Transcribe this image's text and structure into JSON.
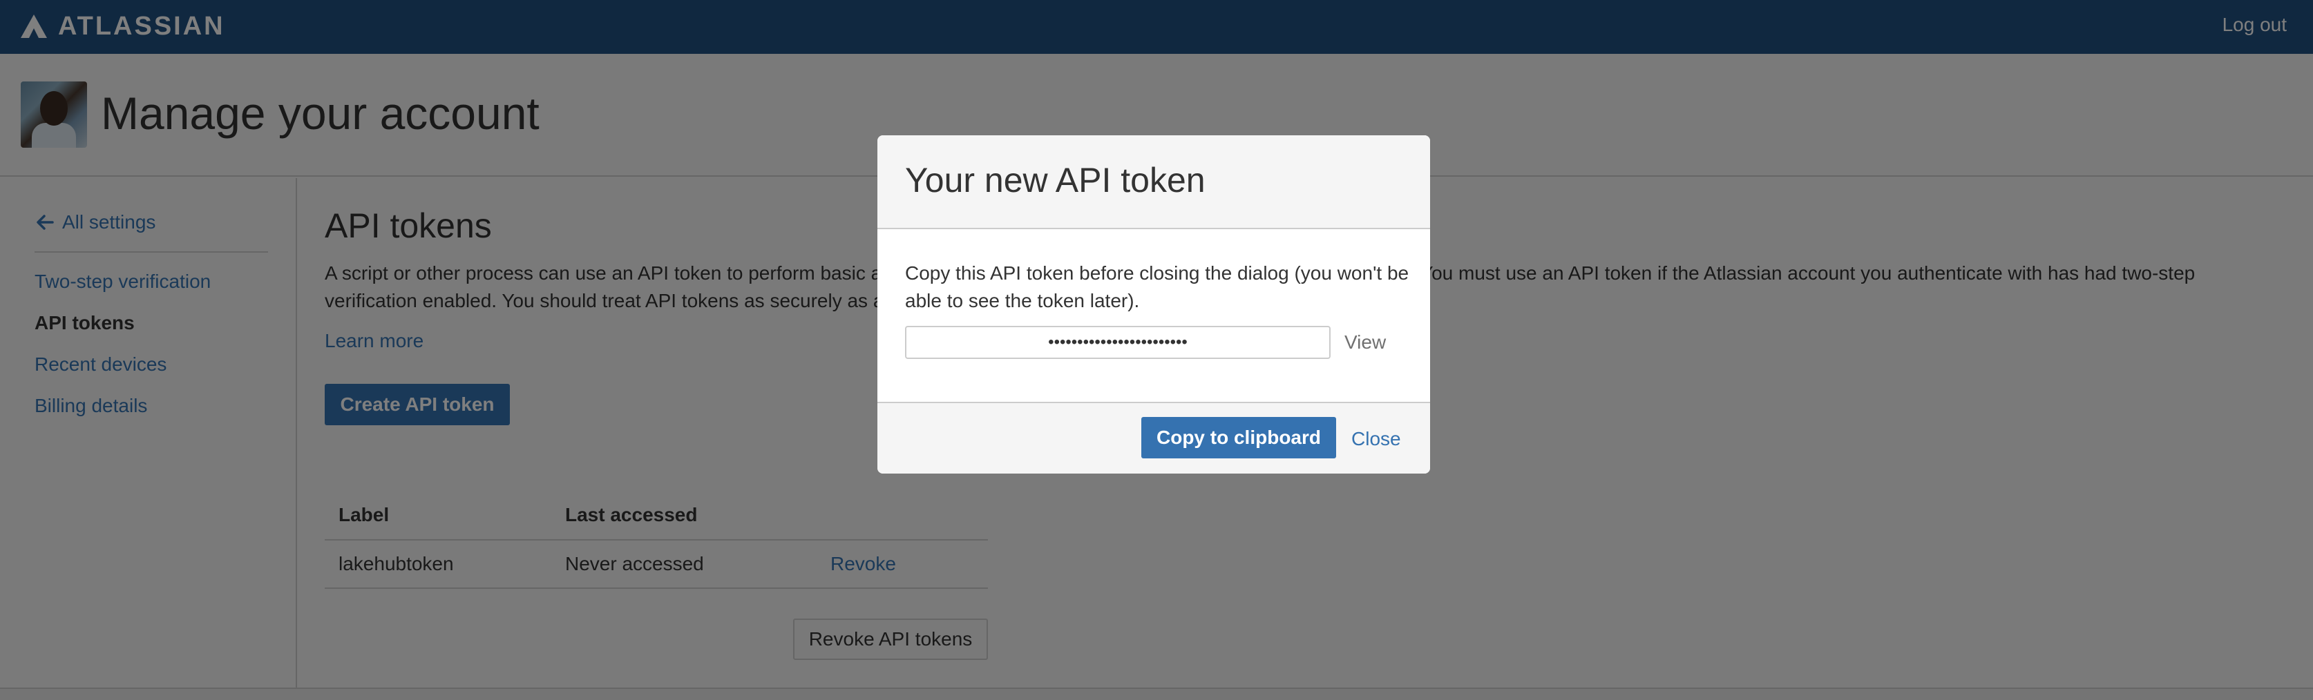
{
  "topbar": {
    "brand": "ATLASSIAN",
    "logout": "Log out"
  },
  "header": {
    "title": "Manage your account"
  },
  "sidebar": {
    "back_label": "All settings",
    "items": [
      {
        "label": "Two-step verification",
        "active": false
      },
      {
        "label": "API tokens",
        "active": true
      },
      {
        "label": "Recent devices",
        "active": false
      },
      {
        "label": "Billing details",
        "active": false
      }
    ]
  },
  "main": {
    "title": "API tokens",
    "description_line1": "A script or other process can use an API token to perform basic a",
    "description_line1_right": "You must use an API token if the Atlassian account you authenticate with has had two-step",
    "description_line2": "verification enabled. You should treat API tokens as securely as a",
    "learn_more": "Learn more",
    "create_button": "Create API token",
    "table": {
      "headers": [
        "Label",
        "Last accessed",
        ""
      ],
      "rows": [
        {
          "label": "lakehubtoken",
          "last_accessed": "Never accessed",
          "action": "Revoke"
        }
      ]
    },
    "revoke_all_button": "Revoke API tokens"
  },
  "dialog": {
    "title": "Your new API token",
    "body": "Copy this API token before closing the dialog (you won't be able to see the token later).",
    "token_masked": "••••••••••••••••••••••••",
    "view_label": "View",
    "copy_button": "Copy to clipboard",
    "close_label": "Close"
  },
  "colors": {
    "brand": "#205081",
    "link": "#3572b0",
    "button": "#3572b0"
  },
  "icons": {
    "logo": "atlassian-logo-icon",
    "back": "arrow-left-icon"
  }
}
